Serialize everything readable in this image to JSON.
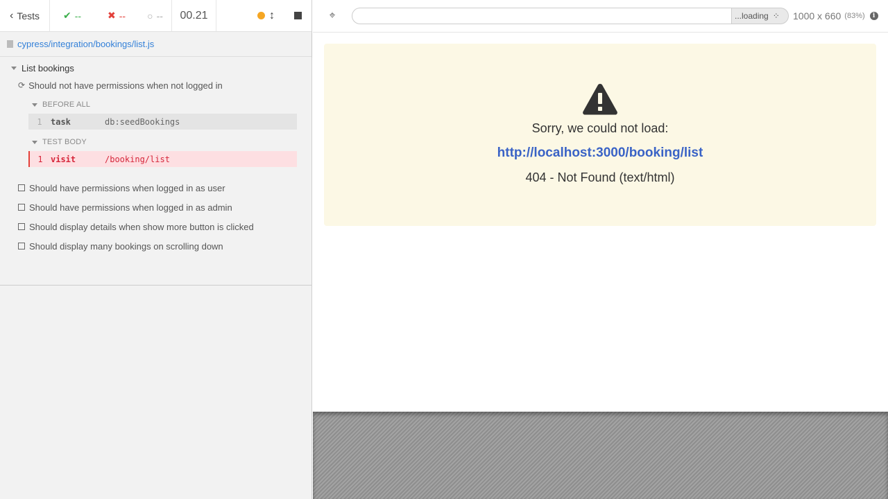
{
  "header": {
    "tests_label": "Tests",
    "passed": "--",
    "failed": "--",
    "pending": "--",
    "duration": "00.21"
  },
  "spec": {
    "path": "cypress/integration/bookings/list.js"
  },
  "suite": {
    "title": "List bookings",
    "active_test": {
      "title": "Should not have permissions when not logged in",
      "hooks": [
        {
          "title": "BEFORE ALL",
          "commands": [
            {
              "num": "1",
              "name": "task",
              "message": "db:seedBookings",
              "state": "passed"
            }
          ]
        },
        {
          "title": "TEST BODY",
          "commands": [
            {
              "num": "1",
              "name": "visit",
              "message": "/booking/list",
              "state": "failed"
            }
          ]
        }
      ]
    },
    "tests": [
      "Should have permissions when logged in as user",
      "Should have permissions when logged in as admin",
      "Should display details when show more button is clicked",
      "Should display many bookings on scrolling down"
    ]
  },
  "browser": {
    "url_value": "",
    "loading_label": "...loading",
    "viewport": "1000 x 660",
    "viewport_pct": "(83%)"
  },
  "error": {
    "title": "Sorry, we could not load:",
    "url": "http://localhost:3000/booking/list",
    "status": "404 - Not Found (text/html)"
  },
  "colors": {
    "passed": "#3bae4a",
    "failed": "#e3403a",
    "link": "#3380d8",
    "error_bg": "#fcf8e5",
    "error_url": "#3a63c6"
  }
}
